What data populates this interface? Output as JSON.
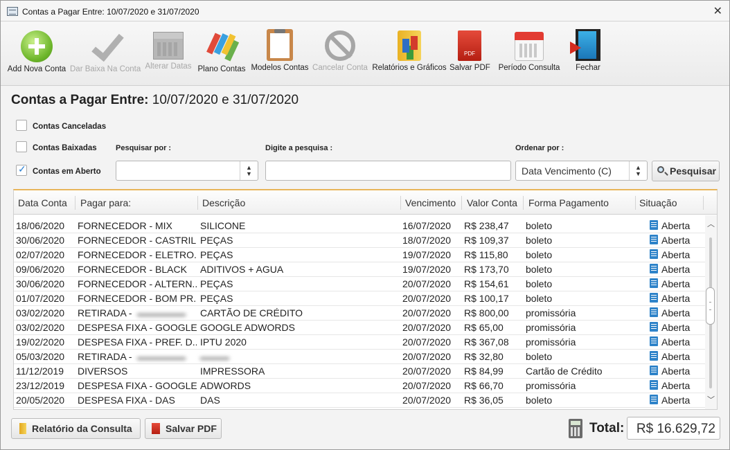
{
  "window": {
    "title": "Contas a Pagar Entre: 10/07/2020 e 31/07/2020"
  },
  "toolbar": {
    "add": "Add Nova Conta",
    "baixa": "Dar Baixa Na Conta",
    "alterar": "Alterar Datas",
    "plano": "Plano Contas",
    "modelos": "Modelos Contas",
    "cancelar": "Cancelar Conta",
    "relatorios": "Relatórios e Gráficos",
    "salvar_pdf": "Salvar PDF",
    "periodo": "Período Consulta",
    "fechar": "Fechar"
  },
  "heading": {
    "label": "Contas a Pagar Entre:",
    "range": "10/07/2020 e 31/07/2020"
  },
  "filters": {
    "canceladas": "Contas Canceladas",
    "baixadas": "Contas Baixadas",
    "aberto": "Contas em Aberto",
    "pesquisar_por_label": "Pesquisar por :",
    "pesquisar_por_value": "",
    "digite_label": "Digite a pesquisa :",
    "digite_value": "",
    "ordenar_label": "Ordenar por :",
    "ordenar_value": "Data Vencimento (C)",
    "search_button": "Pesquisar"
  },
  "table": {
    "columns": [
      "Data Conta",
      "Pagar para:",
      "Descrição",
      "Vencimento",
      "Valor Conta",
      "Forma Pagamento",
      "Situação"
    ],
    "rows": [
      [
        "18/06/2020",
        "FORNECEDOR - MIX",
        "SILICONE",
        "16/07/2020",
        "R$ 238,47",
        "boleto",
        "Aberta"
      ],
      [
        "30/06/2020",
        "FORNECEDOR - CASTRIL...",
        "PEÇAS",
        "18/07/2020",
        "R$ 109,37",
        "boleto",
        "Aberta"
      ],
      [
        "02/07/2020",
        "FORNECEDOR - ELETRO...",
        "PEÇAS",
        "19/07/2020",
        "R$ 115,80",
        "boleto",
        "Aberta"
      ],
      [
        "09/06/2020",
        "FORNECEDOR - BLACK",
        "ADITIVOS + AGUA",
        "19/07/2020",
        "R$ 173,70",
        "boleto",
        "Aberta"
      ],
      [
        "30/06/2020",
        "FORNECEDOR - ALTERN...",
        "PEÇAS",
        "20/07/2020",
        "R$ 154,61",
        "boleto",
        "Aberta"
      ],
      [
        "01/07/2020",
        "FORNECEDOR - BOM PR...",
        "PEÇAS",
        "20/07/2020",
        "R$ 100,17",
        "boleto",
        "Aberta"
      ],
      [
        "03/02/2020",
        "RETIRADA - ",
        "CARTÃO DE CRÉDITO",
        "20/07/2020",
        "R$ 800,00",
        "promissória",
        "Aberta"
      ],
      [
        "03/02/2020",
        "DESPESA FIXA - GOOGLE",
        "GOOGLE ADWORDS",
        "20/07/2020",
        "R$ 65,00",
        "promissória",
        "Aberta"
      ],
      [
        "19/02/2020",
        "DESPESA FIXA - PREF. D...",
        "IPTU 2020",
        "20/07/2020",
        "R$ 367,08",
        "promissória",
        "Aberta"
      ],
      [
        "05/03/2020",
        "RETIRADA - ",
        "",
        "20/07/2020",
        "R$ 32,80",
        "boleto",
        "Aberta"
      ],
      [
        "11/12/2019",
        "DIVERSOS",
        "IMPRESSORA",
        "20/07/2020",
        "R$ 84,99",
        "Cartão de Crédito",
        "Aberta"
      ],
      [
        "23/12/2019",
        "DESPESA FIXA - GOOGLE",
        "ADWORDS",
        "20/07/2020",
        "R$ 66,70",
        "promissória",
        "Aberta"
      ],
      [
        "20/05/2020",
        "DESPESA FIXA - DAS",
        "DAS",
        "20/07/2020",
        "R$ 36,05",
        "boleto",
        "Aberta"
      ]
    ]
  },
  "footer": {
    "relatorio_button": "Relatório da Consulta",
    "pdf_button": "Salvar PDF",
    "total_label": "Total:",
    "total_value": "R$ 16.629,72"
  }
}
